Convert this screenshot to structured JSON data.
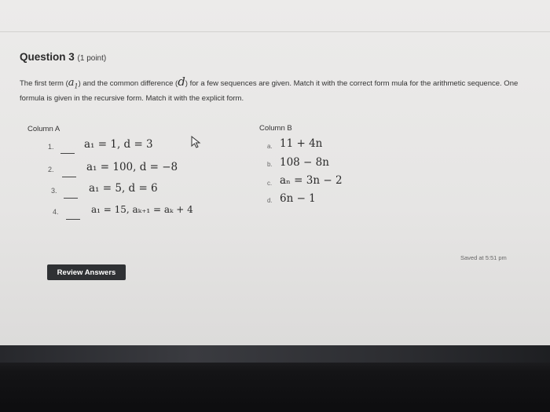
{
  "question": {
    "label": "Question 3",
    "points": "(1 point)"
  },
  "prompt": {
    "part1": "The first term (",
    "a1": "a",
    "a1_sub": "1",
    "part2": ") and the common difference (",
    "d": "d",
    "part3": ") for a few sequences are given. Match it with the correct form mula for the arithmetic sequence. One formula is given in the recursive form. Match it with the explicit form."
  },
  "column_a": {
    "header": "Column A",
    "rows": [
      {
        "number": "1.",
        "expr": "a₁ = 1, d = 3"
      },
      {
        "number": "2.",
        "expr": "a₁ = 100, d = −8"
      },
      {
        "number": "3.",
        "expr": "a₁ = 5, d = 6"
      },
      {
        "number": "4.",
        "expr": "a₁ = 15, aₖ₊₁ = aₖ + 4"
      }
    ]
  },
  "column_b": {
    "header": "Column B",
    "rows": [
      {
        "letter": "a.",
        "expr": "11 + 4n"
      },
      {
        "letter": "b.",
        "expr": "108 − 8n"
      },
      {
        "letter": "c.",
        "expr": "aₙ = 3n − 2"
      },
      {
        "letter": "d.",
        "expr": "6n − 1"
      }
    ]
  },
  "saved_status": "Saved at 5:51 pm",
  "review_button": "Review Answers",
  "icons": {
    "cursor": "mouse-pointer-icon"
  }
}
